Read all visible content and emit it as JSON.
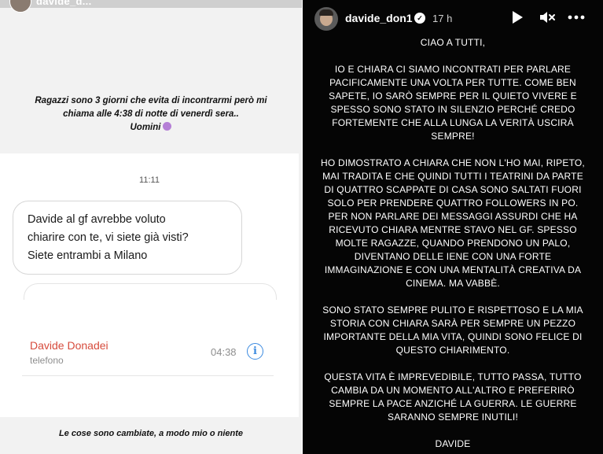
{
  "left_story": {
    "username": "davide_d...",
    "time": "",
    "caption_lines": [
      "Ragazzi sono 3 giorni che evita di incontrarmi però mi",
      "chiama alle 4:38 di notte di venerdì sera..",
      "Uomini"
    ],
    "message_time": "11:11",
    "message_lines": [
      "Davide al gf avrebbe voluto",
      "chiarire con te, vi siete già visti?",
      "Siete entrambi a Milano"
    ],
    "call": {
      "name": "Davide Donadei",
      "type": "telefono",
      "time": "04:38",
      "info_icon": "i"
    },
    "footer_caption": "Le cose sono cambiate, a modo mio o niente"
  },
  "right_story": {
    "username": "davide_don1",
    "verified_icon": "✓",
    "time": "17 h",
    "icons": [
      "play-icon",
      "mute-icon",
      "more-icon"
    ],
    "paragraphs": [
      [
        "CIAO A TUTTI,"
      ],
      [
        "IO E CHIARA CI SIAMO INCONTRATI PER PARLARE",
        "PACIFICAMENTE UNA VOLTA PER TUTTE. COME BEN",
        "SAPETE, IO SARÒ SEMPRE PER IL QUIETO VIVERE E",
        "SPESSO SONO STATO IN SILENZIO PERCHÉ CREDO",
        "FORTEMENTE CHE ALLA LUNGA LA VERITÀ USCIRÀ",
        "SEMPRE!"
      ],
      [
        "HO DIMOSTRATO A CHIARA CHE NON L'HO MAI, RIPETO,",
        "MAI TRADITA E CHE QUINDI TUTTI I TEATRINI DA PARTE",
        "DI QUATTRO SCAPPATE DI CASA SONO SALTATI FUORI",
        "SOLO PER PRENDERE QUATTRO FOLLOWERS IN PO.",
        "PER NON PARLARE DEI MESSAGGI ASSURDI CHE HA",
        "RICEVUTO CHIARA MENTRE STAVO NEL GF. SPESSO",
        "MOLTE RAGAZZE, QUANDO PRENDONO UN PALO,",
        "DIVENTANO DELLE IENE CON UNA FORTE",
        "IMMAGINAZIONE E CON UNA MENTALITÀ CREATIVA DA",
        "CINEMA. MA VABBÈ."
      ],
      [
        "SONO STATO SEMPRE PULITO E RISPETTOSO E LA MIA",
        "STORIA CON CHIARA SARÀ PER SEMPRE UN PEZZO",
        "IMPORTANTE DELLA MIA VITA, QUINDI SONO FELICE DI",
        "QUESTO CHIARIMENTO."
      ],
      [
        "QUESTA VITA È IMPREVEDIBILE, TUTTO PASSA, TUTTO",
        "CAMBIA DA UN MOMENTO ALL'ALTRO E PREFERIRÒ",
        "SEMPRE LA PACE ANZICHÉ LA GUERRA. LE GUERRE",
        "SARANNO SEMPRE INUTILI!"
      ]
    ],
    "signature": "DAVIDE"
  },
  "colors": {
    "call_name": "#d64b3c",
    "info_icon": "#3b8ae0",
    "right_background": "#050505"
  }
}
